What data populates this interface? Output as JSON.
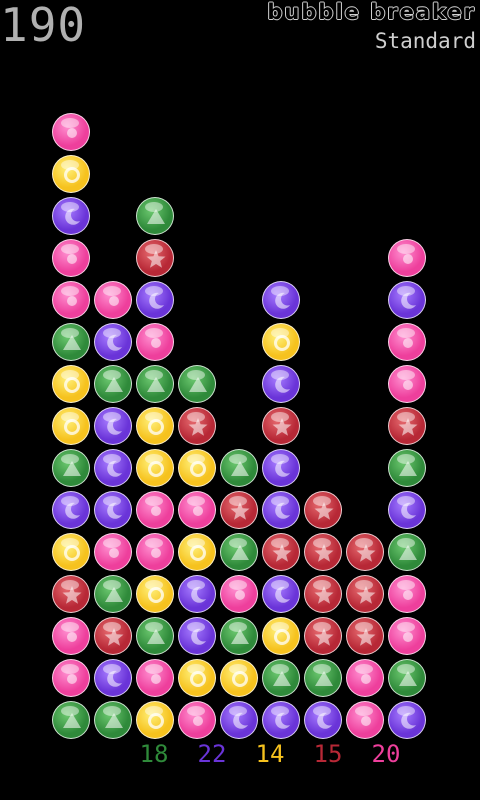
{
  "score": "190",
  "title": "bubble breaker",
  "mode": "Standard",
  "colors": {
    "green": "#2f8a3a",
    "purple": "#6a34d8",
    "yellow": "#f6c21e",
    "red": "#b72836",
    "pink": "#ee3f9c"
  },
  "icons": {
    "green": "triangle-icon",
    "purple": "moon-icon",
    "yellow": "ring-icon",
    "red": "star-icon",
    "pink": "dot-icon"
  },
  "grid": [
    [
      "pink",
      "yellow",
      "purple",
      "pink",
      "pink",
      "green",
      "yellow",
      "yellow",
      "green",
      "purple",
      "yellow",
      "red",
      "pink",
      "pink",
      "green"
    ],
    [
      "",
      "",
      "",
      "",
      "pink",
      "purple",
      "green",
      "purple",
      "purple",
      "purple",
      "pink",
      "green",
      "red",
      "purple",
      "green"
    ],
    [
      "",
      "",
      "green",
      "red",
      "purple",
      "pink",
      "green",
      "yellow",
      "yellow",
      "pink",
      "pink",
      "yellow",
      "green",
      "pink",
      "yellow"
    ],
    [
      "",
      "",
      "",
      "",
      "",
      "",
      "green",
      "red",
      "yellow",
      "pink",
      "yellow",
      "purple",
      "purple",
      "yellow",
      "pink"
    ],
    [
      "",
      "",
      "",
      "",
      "",
      "",
      "",
      "",
      "green",
      "red",
      "green",
      "pink",
      "green",
      "yellow",
      "purple"
    ],
    [
      "",
      "",
      "",
      "",
      "purple",
      "yellow",
      "purple",
      "red",
      "purple",
      "purple",
      "red",
      "purple",
      "yellow",
      "green",
      "purple"
    ],
    [
      "",
      "",
      "",
      "",
      "",
      "",
      "",
      "",
      "",
      "red",
      "red",
      "red",
      "red",
      "green",
      "purple"
    ],
    [
      "",
      "",
      "",
      "",
      "",
      "",
      "",
      "",
      "",
      "",
      "red",
      "red",
      "red",
      "pink",
      "pink"
    ],
    [
      "",
      "",
      "",
      "pink",
      "purple",
      "pink",
      "pink",
      "red",
      "green",
      "purple",
      "green",
      "pink",
      "pink",
      "green",
      "purple"
    ]
  ],
  "counts": [
    {
      "label": "18",
      "color": "#2f8a3a"
    },
    {
      "label": "22",
      "color": "#6a34d8"
    },
    {
      "label": "14",
      "color": "#f6c21e"
    },
    {
      "label": "15",
      "color": "#b72836"
    },
    {
      "label": "20",
      "color": "#ee3f9c"
    }
  ]
}
